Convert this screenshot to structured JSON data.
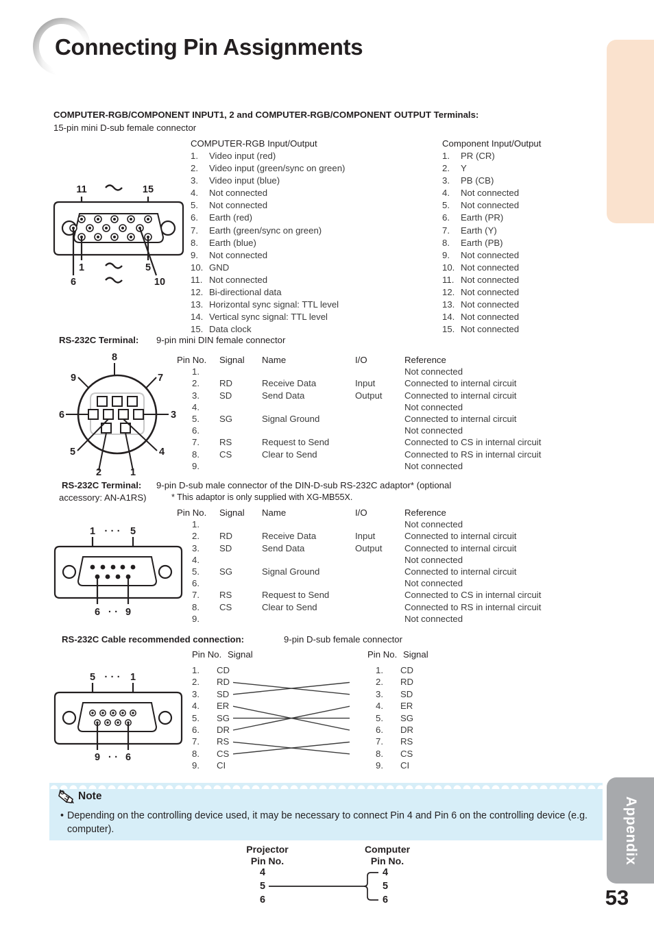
{
  "page": {
    "title": "Connecting Pin Assignments",
    "number": "53",
    "tab_label": "Appendix"
  },
  "section_vga": {
    "heading": "COMPUTER-RGB/COMPONENT INPUT1, 2 and COMPUTER-RGB/COMPONENT OUTPUT Terminals:",
    "subheading": "15-pin mini D-sub female connector",
    "rgb_header": "COMPUTER-RGB Input/Output",
    "component_header": "Component Input/Output",
    "rgb_pins": [
      "Video input (red)",
      "Video input (green/sync on green)",
      "Video input (blue)",
      "Not connected",
      "Not connected",
      "Earth (red)",
      "Earth (green/sync on green)",
      "Earth (blue)",
      "Not connected",
      "GND",
      "Not connected",
      "Bi-directional data",
      "Horizontal sync signal: TTL level",
      "Vertical sync signal: TTL level",
      "Data clock"
    ],
    "component_pins": [
      "PR (CR)",
      "Y",
      "PB (CB)",
      "Not connected",
      "Not connected",
      "Earth (PR)",
      "Earth (Y)",
      "Earth (PB)",
      "Not connected",
      "Not connected",
      "Not connected",
      "Not connected",
      "Not connected",
      "Not connected",
      "Not connected"
    ],
    "diagram_labels": [
      "11",
      "15",
      "1",
      "5",
      "6",
      "10"
    ]
  },
  "section_din": {
    "heading": "RS-232C Terminal:",
    "subheading": "9-pin mini DIN female connector",
    "diagram_labels": [
      "8",
      "9",
      "7",
      "6",
      "3",
      "5",
      "4",
      "2",
      "1"
    ],
    "columns": [
      "Pin No.",
      "Signal",
      "Name",
      "I/O",
      "Reference"
    ],
    "rows": [
      {
        "pin": "1.",
        "signal": "",
        "name": "",
        "io": "",
        "reference": "Not connected"
      },
      {
        "pin": "2.",
        "signal": "RD",
        "name": "Receive Data",
        "io": "Input",
        "reference": "Connected to internal circuit"
      },
      {
        "pin": "3.",
        "signal": "SD",
        "name": "Send Data",
        "io": "Output",
        "reference": "Connected to internal circuit"
      },
      {
        "pin": "4.",
        "signal": "",
        "name": "",
        "io": "",
        "reference": "Not connected"
      },
      {
        "pin": "5.",
        "signal": "SG",
        "name": "Signal Ground",
        "io": "",
        "reference": "Connected to internal circuit"
      },
      {
        "pin": "6.",
        "signal": "",
        "name": "",
        "io": "",
        "reference": "Not connected"
      },
      {
        "pin": "7.",
        "signal": "RS",
        "name": "Request to Send",
        "io": "",
        "reference": "Connected to CS in internal circuit"
      },
      {
        "pin": "8.",
        "signal": "CS",
        "name": "Clear to Send",
        "io": "",
        "reference": "Connected to RS in internal circuit"
      },
      {
        "pin": "9.",
        "signal": "",
        "name": "",
        "io": "",
        "reference": "Not connected"
      }
    ]
  },
  "section_dsub": {
    "heading": "RS-232C Terminal:",
    "subheading_line1": "9-pin D-sub male connector of the DIN-D-sub RS-232C adaptor* (optional",
    "subheading_line2": "accessory: AN-A1RS)",
    "footnote": "*  This adaptor is only supplied with XG-MB55X.",
    "diagram_labels": [
      "1",
      "5",
      "6",
      "9"
    ],
    "columns": [
      "Pin No.",
      "Signal",
      "Name",
      "I/O",
      "Reference"
    ],
    "rows": [
      {
        "pin": "1.",
        "signal": "",
        "name": "",
        "io": "",
        "reference": "Not connected"
      },
      {
        "pin": "2.",
        "signal": "RD",
        "name": "Receive Data",
        "io": "Input",
        "reference": "Connected to internal circuit"
      },
      {
        "pin": "3.",
        "signal": "SD",
        "name": "Send Data",
        "io": "Output",
        "reference": "Connected to internal circuit"
      },
      {
        "pin": "4.",
        "signal": "",
        "name": "",
        "io": "",
        "reference": "Not connected"
      },
      {
        "pin": "5.",
        "signal": "SG",
        "name": "Signal Ground",
        "io": "",
        "reference": "Connected to internal circuit"
      },
      {
        "pin": "6.",
        "signal": "",
        "name": "",
        "io": "",
        "reference": "Not connected"
      },
      {
        "pin": "7.",
        "signal": "RS",
        "name": "Request to Send",
        "io": "",
        "reference": "Connected to CS in internal circuit"
      },
      {
        "pin": "8.",
        "signal": "CS",
        "name": "Clear to Send",
        "io": "",
        "reference": "Connected to RS in internal circuit"
      },
      {
        "pin": "9.",
        "signal": "",
        "name": "",
        "io": "",
        "reference": "Not connected"
      }
    ]
  },
  "section_cable": {
    "heading": "RS-232C Cable recommended connection:",
    "subheading": "9-pin D-sub female connector",
    "diagram_labels": [
      "5",
      "1",
      "9",
      "6"
    ],
    "columns": [
      "Pin No.",
      "Signal"
    ],
    "left_rows": [
      {
        "pin": "1.",
        "signal": "CD"
      },
      {
        "pin": "2.",
        "signal": "RD"
      },
      {
        "pin": "3.",
        "signal": "SD"
      },
      {
        "pin": "4.",
        "signal": "ER"
      },
      {
        "pin": "5.",
        "signal": "SG"
      },
      {
        "pin": "6.",
        "signal": "DR"
      },
      {
        "pin": "7.",
        "signal": "RS"
      },
      {
        "pin": "8.",
        "signal": "CS"
      },
      {
        "pin": "9.",
        "signal": "CI"
      }
    ],
    "right_rows": [
      {
        "pin": "1.",
        "signal": "CD"
      },
      {
        "pin": "2.",
        "signal": "RD"
      },
      {
        "pin": "3.",
        "signal": "SD"
      },
      {
        "pin": "4.",
        "signal": "ER"
      },
      {
        "pin": "5.",
        "signal": "SG"
      },
      {
        "pin": "6.",
        "signal": "DR"
      },
      {
        "pin": "7.",
        "signal": "RS"
      },
      {
        "pin": "8.",
        "signal": "CS"
      },
      {
        "pin": "9.",
        "signal": "CI"
      }
    ],
    "crossings": [
      {
        "from": 2,
        "to": 3
      },
      {
        "from": 3,
        "to": 2
      },
      {
        "from": 4,
        "to": 6
      },
      {
        "from": 5,
        "to": 5
      },
      {
        "from": 6,
        "to": 4
      },
      {
        "from": 7,
        "to": 8
      },
      {
        "from": 8,
        "to": 7
      }
    ]
  },
  "note": {
    "title": "Note",
    "bullet": "•",
    "text": "Depending on the controlling device used, it may be necessary to connect Pin 4 and Pin 6 on the controlling device (e.g. computer)."
  },
  "bottom_diagram": {
    "left_header_line1": "Projector",
    "left_header_line2": "Pin No.",
    "right_header_line1": "Computer",
    "right_header_line2": "Pin No.",
    "left_pins": [
      "4",
      "5",
      "6"
    ],
    "right_pins": [
      "4",
      "5",
      "6"
    ]
  },
  "colors": {
    "tab_peach": "#fae2ce",
    "tab_gray": "#a7a9ac",
    "note_bg": "#d7eef8",
    "text": "#231f20"
  }
}
